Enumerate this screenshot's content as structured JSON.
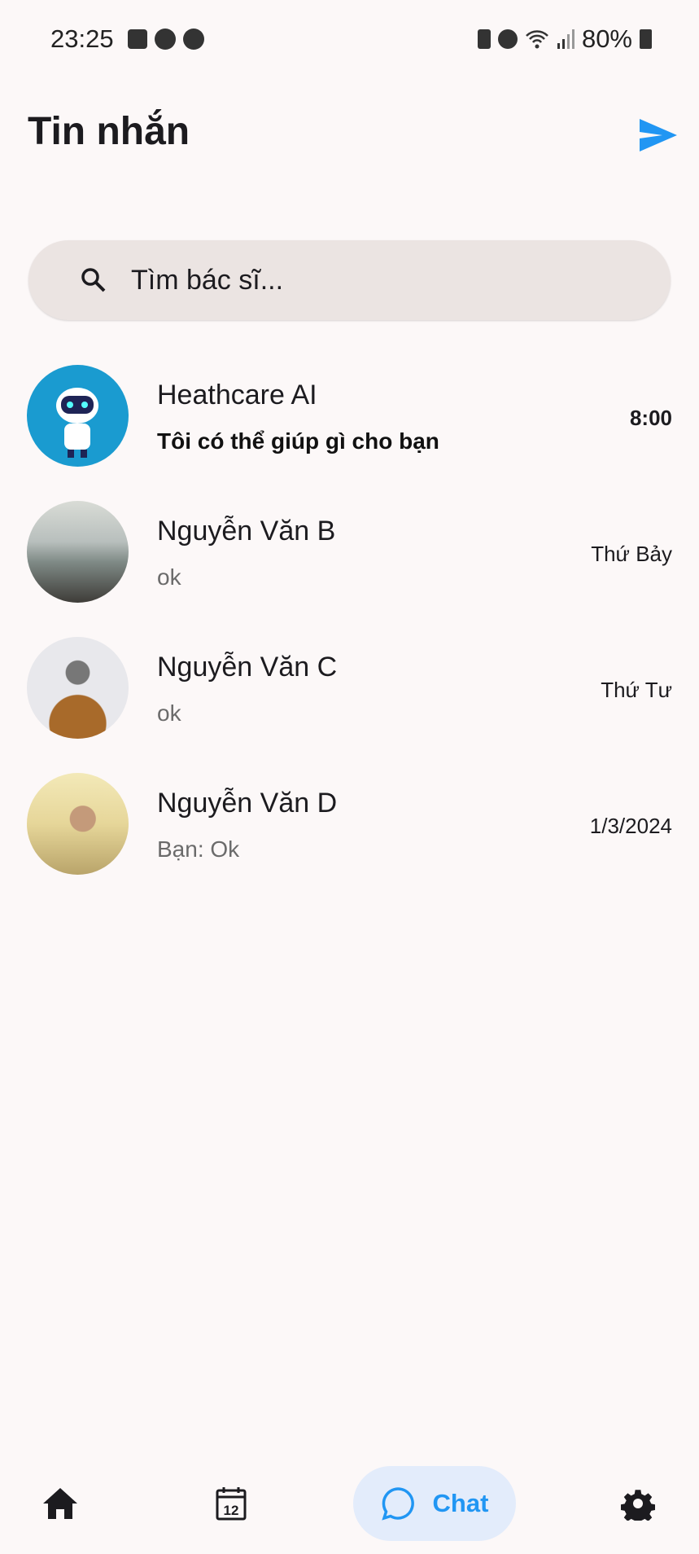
{
  "status_bar": {
    "time": "23:25",
    "battery": "80%",
    "left_icons": [
      "gallery-icon",
      "messenger-icon",
      "messenger-icon"
    ],
    "right_icons": [
      "battery-saver-icon",
      "alarm-icon",
      "wifi-icon",
      "signal-icon",
      "battery-icon"
    ]
  },
  "header": {
    "title": "Tin nhắn",
    "action_icon": "send-icon",
    "accent": "#2196f3"
  },
  "search": {
    "placeholder": "Tìm bác sĩ...",
    "value": ""
  },
  "conversations": [
    {
      "name": "Heathcare AI",
      "preview": "Tôi có thể giúp gì cho bạn",
      "time": "8:00",
      "unread": true,
      "avatar": "robot"
    },
    {
      "name": "Nguyễn Văn B",
      "preview": "ok",
      "time": "Thứ Bảy",
      "unread": false,
      "avatar": "landscape"
    },
    {
      "name": "Nguyễn Văn C",
      "preview": "ok",
      "time": "Thứ Tư",
      "unread": false,
      "avatar": "person-hat"
    },
    {
      "name": "Nguyễn Văn D",
      "preview": "Bạn: Ok",
      "time": "1/3/2024",
      "unread": false,
      "avatar": "woman-sunglasses"
    }
  ],
  "bottom_nav": {
    "items": [
      {
        "icon": "home-icon"
      },
      {
        "icon": "calendar-icon",
        "badge_text": "12"
      },
      {
        "icon": "chat-icon",
        "label": "Chat",
        "active": true
      },
      {
        "icon": "settings-icon"
      }
    ]
  }
}
